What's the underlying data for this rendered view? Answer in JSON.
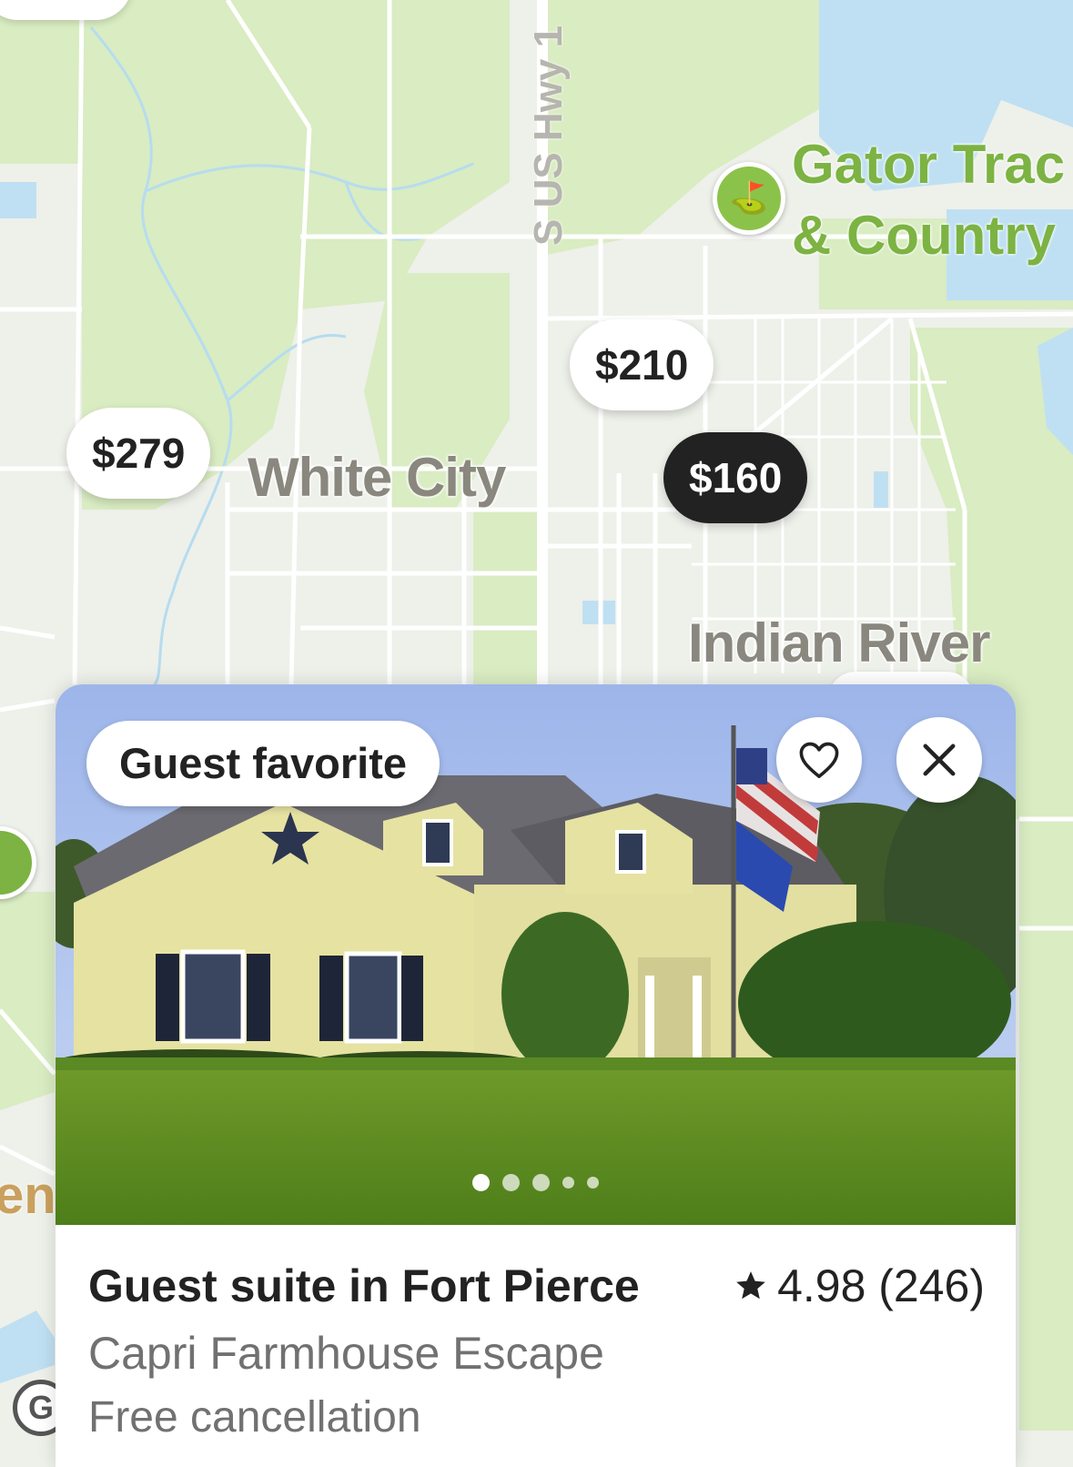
{
  "map": {
    "places": {
      "white_city": "White City",
      "indian_river": "Indian River",
      "partial_left": "en"
    },
    "roads": {
      "us1": "S US Hwy 1"
    },
    "poi": {
      "line1": "Gator Trac",
      "line2": "& Country",
      "icon": "golf-icon"
    },
    "price_pins": [
      {
        "label": "$210",
        "selected": false
      },
      {
        "label": "$279",
        "selected": false
      },
      {
        "label": "$160",
        "selected": true
      }
    ],
    "colors": {
      "land": "#eef0ea",
      "park": "#d9ecc2",
      "water": "#bfe0f2",
      "road": "#ffffff",
      "poi": "#7cb342"
    }
  },
  "card": {
    "badge": "Guest favorite",
    "favorite_icon": "heart-icon",
    "close_icon": "close-icon",
    "photo_count": 5,
    "active_photo": 1,
    "title": "Guest suite in Fort Pierce",
    "rating_icon": "star-icon",
    "rating": "4.98 (246)",
    "subtitle": "Capri Farmhouse Escape",
    "extra": "Free cancellation"
  }
}
